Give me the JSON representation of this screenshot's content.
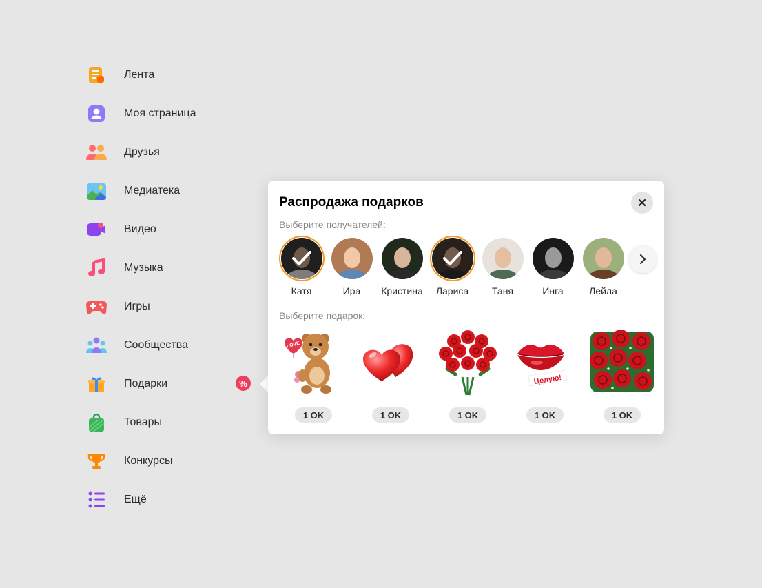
{
  "sidebar": {
    "items": [
      {
        "label": "Лента",
        "icon": "feed-icon"
      },
      {
        "label": "Моя страница",
        "icon": "profile-icon"
      },
      {
        "label": "Друзья",
        "icon": "friends-icon"
      },
      {
        "label": "Медиатека",
        "icon": "gallery-icon"
      },
      {
        "label": "Видео",
        "icon": "video-icon"
      },
      {
        "label": "Музыка",
        "icon": "music-icon"
      },
      {
        "label": "Игры",
        "icon": "gamepad-icon"
      },
      {
        "label": "Сообщества",
        "icon": "groups-icon"
      },
      {
        "label": "Подарки",
        "icon": "gift-icon"
      },
      {
        "label": "Товары",
        "icon": "shopping-bag-icon"
      },
      {
        "label": "Конкурсы",
        "icon": "trophy-icon"
      },
      {
        "label": "Ещё",
        "icon": "list-icon"
      }
    ],
    "sale_badge": "%"
  },
  "popup": {
    "title": "Распродажа подарков",
    "close_icon": "close-icon",
    "recipients_label": "Выберите получателей:",
    "recipients": [
      {
        "name": "Катя",
        "selected": true
      },
      {
        "name": "Ира",
        "selected": false
      },
      {
        "name": "Кристина",
        "selected": false
      },
      {
        "name": "Лариса",
        "selected": true
      },
      {
        "name": "Таня",
        "selected": false
      },
      {
        "name": "Инга",
        "selected": false
      },
      {
        "name": "Лейла",
        "selected": false
      }
    ],
    "gifts_label": "Выберите подарок:",
    "gifts": [
      {
        "name": "teddy-bear",
        "price": "1 OK"
      },
      {
        "name": "hearts",
        "price": "1 OK"
      },
      {
        "name": "rose-bouquet",
        "price": "1 OK"
      },
      {
        "name": "lips",
        "price": "1 OK",
        "caption": "Целую!"
      },
      {
        "name": "rose-box",
        "price": "1 OK"
      }
    ],
    "teddy_caption": "LOVE"
  },
  "colors": {
    "accent": "#f59a23",
    "badge": "#ee3f5f",
    "background": "#e6e6e6"
  }
}
